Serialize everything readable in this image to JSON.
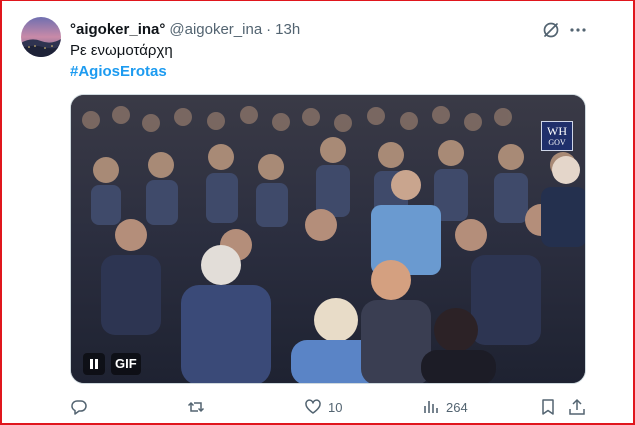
{
  "tweet": {
    "display_name": "°aigoker_ina°",
    "handle": "@aigoker_ina",
    "separator": "·",
    "time": "13h",
    "text": "Ρε ενωμοτάρχη",
    "hashtag": "#AgiosErotas"
  },
  "media": {
    "badge_top": "WH",
    "badge_bottom": "GOV",
    "gif_label": "GIF"
  },
  "actions": {
    "reply_count": "",
    "retweet_count": "",
    "like_count": "10",
    "views_count": "264"
  },
  "icons": [
    "grok-icon",
    "more-icon",
    "pause-icon",
    "reply-icon",
    "retweet-icon",
    "like-icon",
    "views-icon",
    "bookmark-icon",
    "share-icon"
  ],
  "colors": {
    "accent": "#1d9bf0",
    "muted": "#536471",
    "frame": "#e0161d"
  }
}
